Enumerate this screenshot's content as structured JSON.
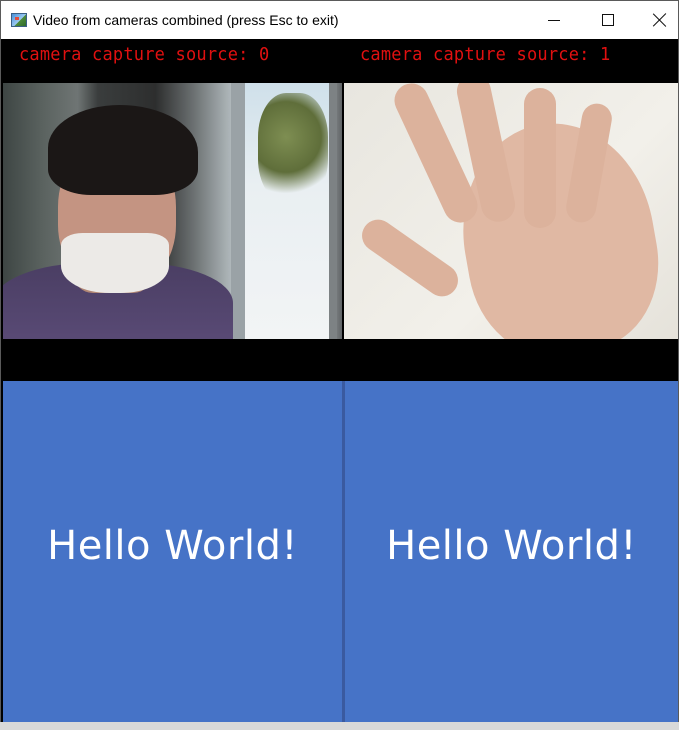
{
  "window": {
    "title": "Video from cameras combined (press Esc to exit)",
    "icon": "video-app-icon",
    "controls": {
      "minimize": "minimize-icon",
      "maximize": "maximize-icon",
      "close": "close-icon"
    }
  },
  "cameras": [
    {
      "caption": "camera capture source: 0",
      "caption_color": "#e01010"
    },
    {
      "caption": "camera capture source: 1",
      "caption_color": "#e01010"
    }
  ],
  "panels": [
    {
      "text": "Hello World!",
      "background": "#4673c7"
    },
    {
      "text": "Hello World!",
      "background": "#4673c7"
    }
  ]
}
